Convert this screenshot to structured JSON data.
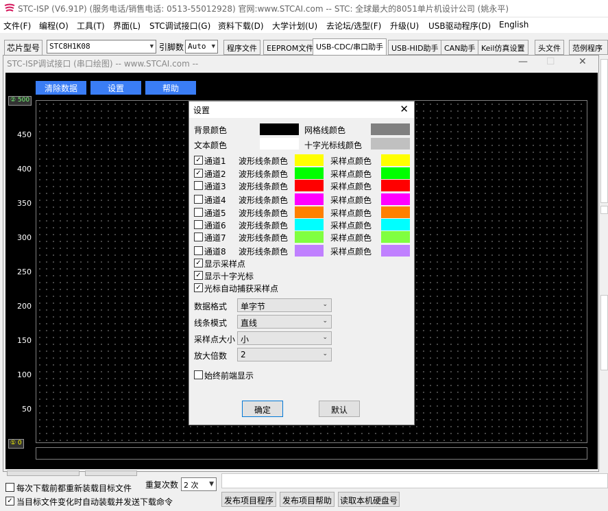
{
  "window": {
    "title": "STC-ISP (V6.91P) (服务电话/销售电话: 0513-55012928) 官网:www.STCAI.com  -- STC: 全球最大的8051单片机设计公司 (姚永平)"
  },
  "menu": [
    "文件(F)",
    "编程(O)",
    "工具(T)",
    "界面(L)",
    "STC调试接口(G)",
    "资料下载(D)",
    "大学计划(U)",
    "去论坛/选型(F)",
    "升级(U)",
    "USB驱动程序(D)",
    "English"
  ],
  "chip": {
    "label": "芯片型号",
    "value": "STC8H1K08",
    "pins_label": "引脚数",
    "pins_value": "Auto"
  },
  "tabs": [
    "程序文件",
    "EEPROM文件",
    "USB-CDC/串口助手",
    "USB-HID助手",
    "CAN助手",
    "Keil仿真设置",
    "头文件",
    "范例程序"
  ],
  "scope": {
    "title": "STC-ISP调试接口 (串口绘图) -- www.STCAI.com --",
    "buttons": [
      "清除数据",
      "设置",
      "帮助"
    ],
    "y_ticks": [
      "500",
      "450",
      "400",
      "350",
      "300",
      "250",
      "200",
      "150",
      "100",
      "50",
      "0"
    ],
    "marker_top": "② 500",
    "marker_bottom": "① 0"
  },
  "bottom": {
    "repeat_label": "重复次数",
    "repeat_value": "2 次",
    "check1": "每次下载前都重新装载目标文件",
    "check2": "当目标文件变化时自动装载并发送下载命令",
    "btn_publish": "发布项目程序",
    "btn_help": "发布项目帮助",
    "btn_disk": "读取本机硬盘号"
  },
  "dialog": {
    "title": "设置",
    "bg_label": "背景颜色",
    "grid_label": "网格线颜色",
    "text_label": "文本颜色",
    "cursor_label": "十字光标线颜色",
    "wave_label": "波形线条颜色",
    "sample_label": "采样点颜色",
    "channels": [
      {
        "name": "通道1",
        "checked": true,
        "color": "#ffff00"
      },
      {
        "name": "通道2",
        "checked": true,
        "color": "#00ff00"
      },
      {
        "name": "通道3",
        "checked": false,
        "color": "#ff0000"
      },
      {
        "name": "通道4",
        "checked": false,
        "color": "#ff00ff"
      },
      {
        "name": "通道5",
        "checked": false,
        "color": "#ff8000"
      },
      {
        "name": "通道6",
        "checked": false,
        "color": "#00ffff"
      },
      {
        "name": "通道7",
        "checked": false,
        "color": "#80ff40"
      },
      {
        "name": "通道8",
        "checked": false,
        "color": "#c080ff"
      }
    ],
    "options": [
      {
        "label": "显示采样点",
        "checked": true
      },
      {
        "label": "显示十字光标",
        "checked": true
      },
      {
        "label": "光标自动捕获采样点",
        "checked": true
      }
    ],
    "data_format_label": "数据格式",
    "data_format": "单字节",
    "line_mode_label": "线条模式",
    "line_mode": "直线",
    "point_size_label": "采样点大小",
    "point_size": "小",
    "zoom_label": "放大倍数",
    "zoom": "2",
    "topmost_label": "始终前端显示",
    "ok": "确定",
    "default": "默认"
  },
  "colors": {
    "bg": "#000000",
    "grid": "#808080",
    "text": "#ffffff",
    "cursor": "#c0c0c0",
    "accent": "#3a7df5"
  }
}
